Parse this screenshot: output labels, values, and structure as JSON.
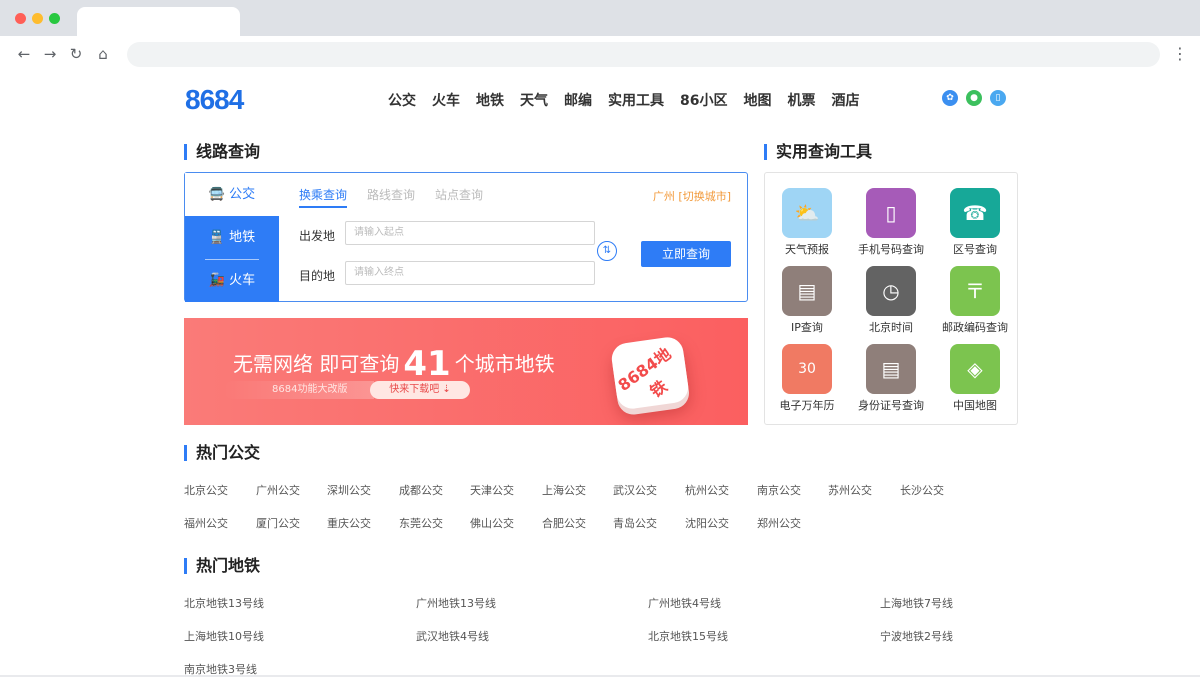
{
  "header": {
    "logo": "8684",
    "nav": [
      "公交",
      "火车",
      "地铁",
      "天气",
      "邮编",
      "实用工具",
      "86小区",
      "地图",
      "机票",
      "酒店"
    ],
    "social_icons": [
      "weibo-icon",
      "wechat-icon",
      "mobile-icon"
    ]
  },
  "route_query": {
    "title": "线路查询",
    "side_tabs": {
      "bus": "公交",
      "subway": "地铁",
      "train": "火车"
    },
    "mode_tabs": [
      "换乘查询",
      "路线查询",
      "站点查询"
    ],
    "city": "广州 [切换城市]",
    "from_label": "出发地",
    "from_placeholder": "请输入起点",
    "to_label": "目的地",
    "to_placeholder": "请输入终点",
    "search_button": "立即查询"
  },
  "banner": {
    "text_before": "无需网络 即可查询",
    "number": "41",
    "text_after": "个城市地铁",
    "sub_text": "8684功能大改版",
    "button": "快来下载吧 ⇣",
    "icon_text": "8684地铁"
  },
  "tools": {
    "title": "实用查询工具",
    "items": [
      {
        "label": "天气预报",
        "icon": "weather-icon",
        "color": "#9fd5f5"
      },
      {
        "label": "手机号码查询",
        "icon": "phone-icon",
        "color": "#a65bb8"
      },
      {
        "label": "区号查询",
        "icon": "telephone-icon",
        "color": "#17a898"
      },
      {
        "label": "IP查询",
        "icon": "id-card-icon",
        "color": "#8f7f7a"
      },
      {
        "label": "北京时间",
        "icon": "clock-icon",
        "color": "#636363"
      },
      {
        "label": "邮政编码查询",
        "icon": "postal-icon",
        "color": "#7cc44f"
      },
      {
        "label": "电子万年历",
        "icon": "calendar-icon",
        "color": "#f07a63"
      },
      {
        "label": "身份证号查询",
        "icon": "id-card-icon",
        "color": "#8f7f7a"
      },
      {
        "label": "中国地图",
        "icon": "china-map-icon",
        "color": "#7cc44f"
      }
    ]
  },
  "hot_bus": {
    "title": "热门公交",
    "row1": [
      "北京公交",
      "广州公交",
      "深圳公交",
      "成都公交",
      "天津公交",
      "上海公交",
      "武汉公交",
      "杭州公交",
      "南京公交",
      "苏州公交",
      "长沙公交"
    ],
    "row2": [
      "福州公交",
      "厦门公交",
      "重庆公交",
      "东莞公交",
      "佛山公交",
      "合肥公交",
      "青岛公交",
      "沈阳公交",
      "郑州公交"
    ]
  },
  "hot_subway": {
    "title": "热门地铁",
    "rows": [
      [
        "北京地铁13号线",
        "广州地铁13号线",
        "广州地铁4号线",
        "上海地铁7号线"
      ],
      [
        "上海地铁10号线",
        "武汉地铁4号线",
        "北京地铁15号线",
        "宁波地铁2号线"
      ],
      [
        "南京地铁3号线"
      ]
    ]
  }
}
